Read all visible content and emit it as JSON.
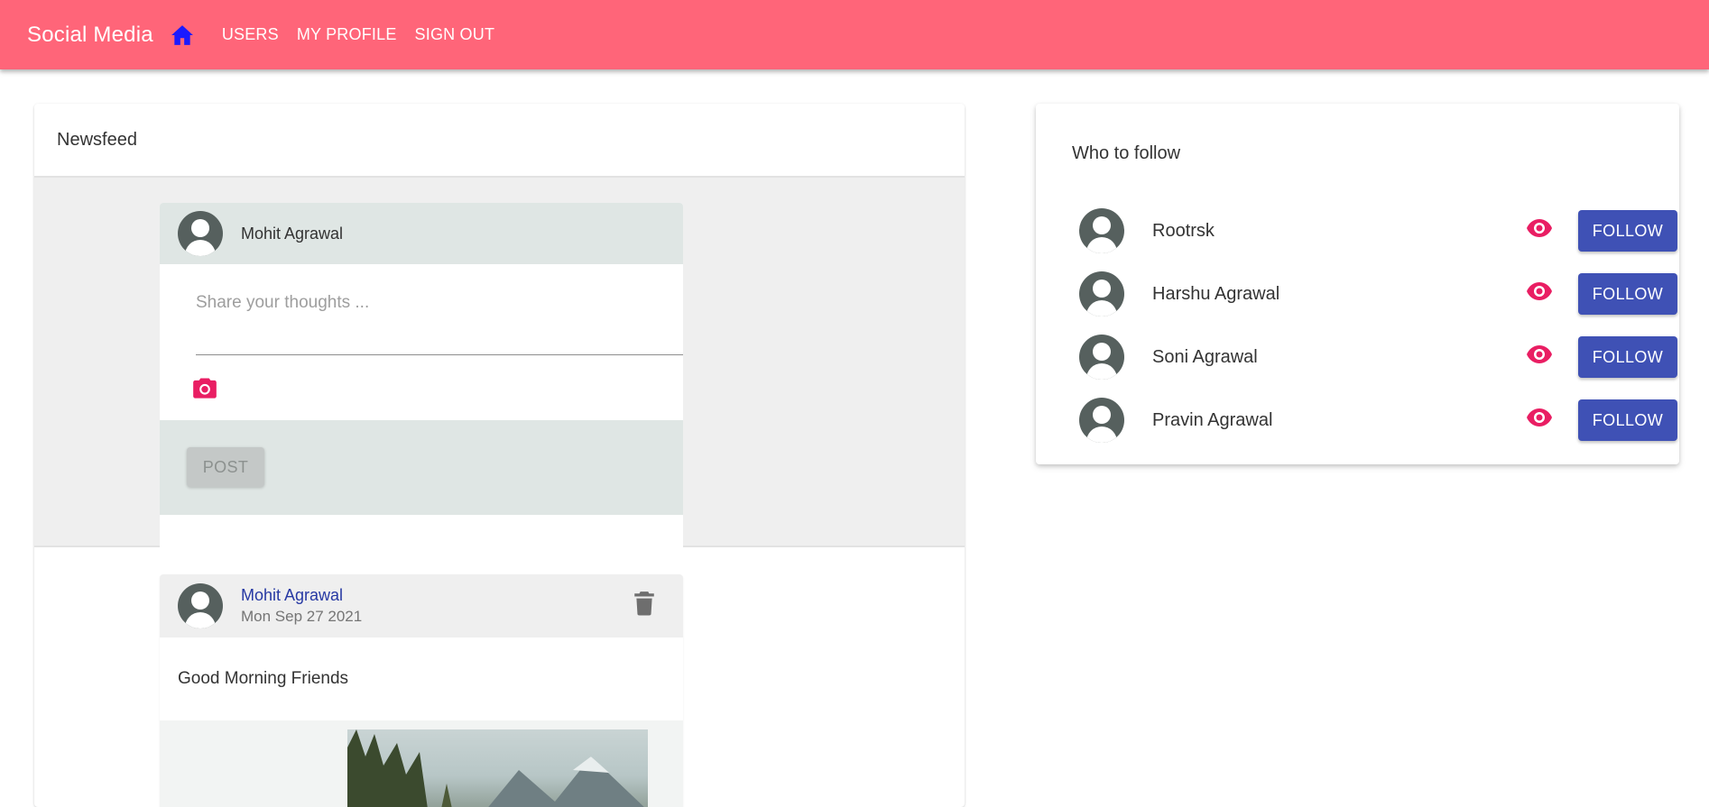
{
  "appbar": {
    "brand": "Social Media",
    "home_icon": "home-icon",
    "nav": [
      "USERS",
      "MY PROFILE",
      "SIGN OUT"
    ],
    "background": "#ff6579"
  },
  "newsfeed": {
    "title": "Newsfeed",
    "compose": {
      "user_name": "Mohit Agrawal",
      "placeholder": "Share your thoughts ...",
      "value": "",
      "camera_icon": "camera-icon",
      "post_label": "POST"
    },
    "posts": [
      {
        "author": "Mohit Agrawal",
        "date": "Mon Sep 27 2021",
        "text": "Good Morning Friends",
        "delete_icon": "trash-icon"
      }
    ]
  },
  "who_to_follow": {
    "title": "Who to follow",
    "users": [
      {
        "name": "Rootrsk",
        "follow_label": "FOLLOW"
      },
      {
        "name": "Harshu Agrawal",
        "follow_label": "FOLLOW"
      },
      {
        "name": "Soni Agrawal",
        "follow_label": "FOLLOW"
      },
      {
        "name": "Pravin Agrawal",
        "follow_label": "FOLLOW"
      }
    ],
    "accent_color": "#e91e63",
    "button_color": "#3f51b5"
  }
}
